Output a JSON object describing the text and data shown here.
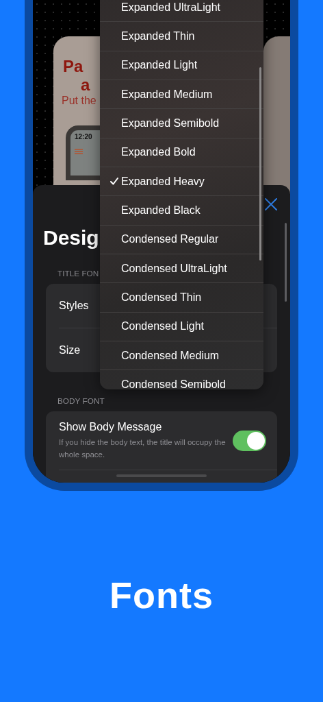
{
  "preview_card": {
    "title_lines": [
      "Pa",
      "a"
    ],
    "subtitle": "Put the",
    "time": "12:20"
  },
  "sheet": {
    "title": "Desig",
    "sections": [
      {
        "header": "TITLE FON",
        "rows": [
          {
            "kind": "value",
            "label": "Styles"
          },
          {
            "kind": "value",
            "label": "Size"
          }
        ]
      },
      {
        "header": "BODY FONT",
        "rows": [
          {
            "kind": "toggle",
            "label": "Show Body Message",
            "description": "If you hide the body text, the title will occupy the whole space.",
            "on": true
          }
        ]
      }
    ]
  },
  "menu": {
    "items": [
      {
        "label": "Expanded UltraLight",
        "selected": false
      },
      {
        "label": "Expanded Thin",
        "selected": false
      },
      {
        "label": "Expanded Light",
        "selected": false
      },
      {
        "label": "Expanded Medium",
        "selected": false
      },
      {
        "label": "Expanded Semibold",
        "selected": false
      },
      {
        "label": "Expanded Bold",
        "selected": false
      },
      {
        "label": "Expanded Heavy",
        "selected": true
      },
      {
        "label": "Expanded Black",
        "selected": false
      },
      {
        "label": "Condensed Regular",
        "selected": false
      },
      {
        "label": "Condensed UltraLight",
        "selected": false
      },
      {
        "label": "Condensed Thin",
        "selected": false
      },
      {
        "label": "Condensed Light",
        "selected": false
      },
      {
        "label": "Condensed Medium",
        "selected": false
      },
      {
        "label": "Condensed Semibold",
        "selected": false
      }
    ]
  },
  "caption": "Fonts"
}
